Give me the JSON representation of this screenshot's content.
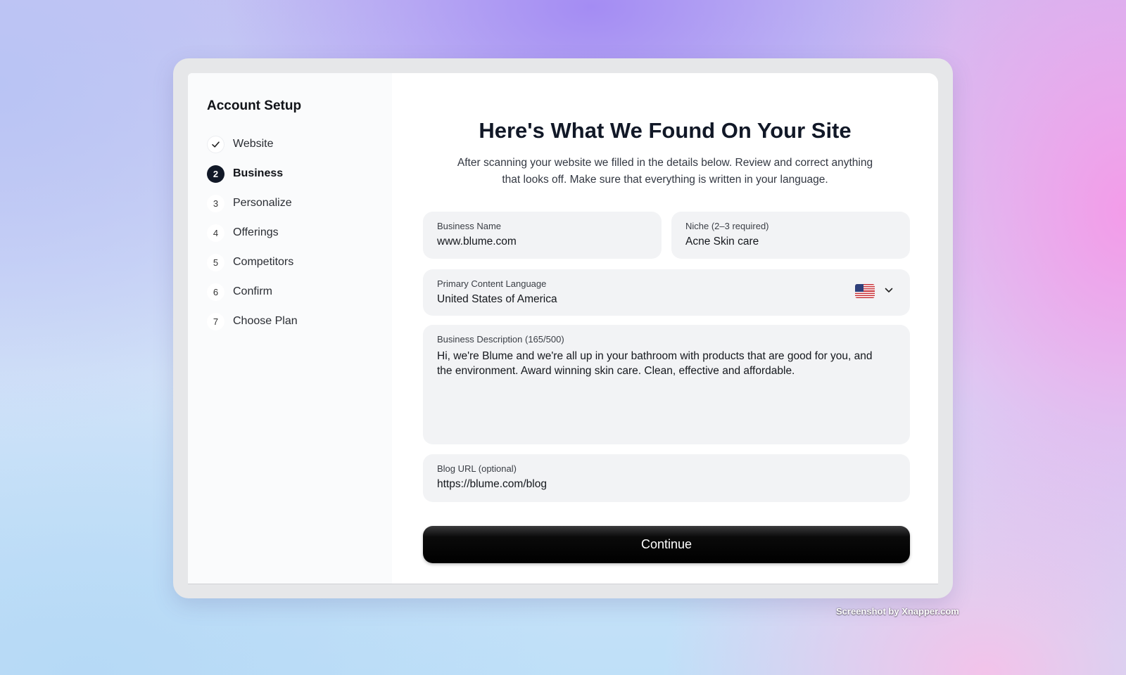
{
  "sidebar": {
    "title": "Account Setup",
    "steps": [
      {
        "marker": "",
        "label": "Website",
        "state": "done"
      },
      {
        "marker": "2",
        "label": "Business",
        "state": "active"
      },
      {
        "marker": "3",
        "label": "Personalize",
        "state": "pending"
      },
      {
        "marker": "4",
        "label": "Offerings",
        "state": "pending"
      },
      {
        "marker": "5",
        "label": "Competitors",
        "state": "pending"
      },
      {
        "marker": "6",
        "label": "Confirm",
        "state": "pending"
      },
      {
        "marker": "7",
        "label": "Choose Plan",
        "state": "pending"
      }
    ],
    "done_icon": "checkmark-icon"
  },
  "main": {
    "heading": "Here's What We Found On Your Site",
    "subheading": "After scanning your website we filled in the details below. Review and correct anything that looks off. Make sure that everything is written in your language.",
    "business_name": {
      "label": "Business Name",
      "value": "www.blume.com"
    },
    "niche": {
      "label": "Niche (2–3 required)",
      "value": "Acne Skin care"
    },
    "language": {
      "label": "Primary Content Language",
      "value": "United States of America",
      "flag_icon": "us-flag-icon",
      "dropdown_icon": "chevron-down-icon"
    },
    "description": {
      "label": "Business Description (165/500)",
      "value": "Hi, we're Blume and we're all up in your bathroom with products that are good for you, and the environment. Award winning skin care. Clean, effective and affordable."
    },
    "blog_url": {
      "label": "Blog URL (optional)",
      "value": "https://blume.com/blog"
    },
    "continue_label": "Continue"
  },
  "watermark": "Screenshot by Xnapper.com",
  "colors": {
    "primary_button": "#000000",
    "active_step": "#111827",
    "field_bg": "#f2f3f5"
  }
}
